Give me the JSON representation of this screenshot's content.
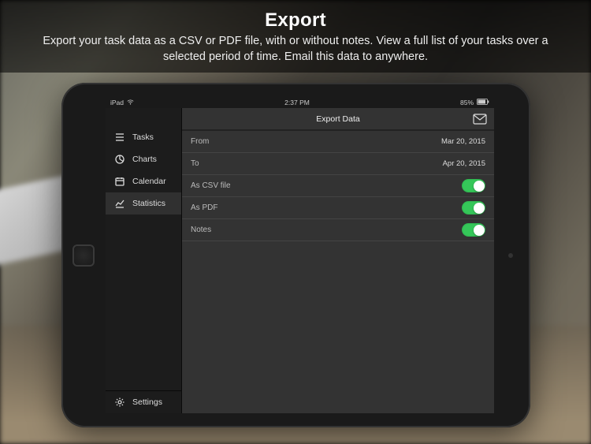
{
  "promo": {
    "title": "Export",
    "description": "Export your task data as a CSV or PDF file, with or without notes. View a full list of your tasks over a selected period of time. Email this data to anywhere."
  },
  "status": {
    "carrier": "iPad",
    "time": "2:37 PM",
    "battery": "85%"
  },
  "sidebar": {
    "items": [
      {
        "label": "Tasks"
      },
      {
        "label": "Charts"
      },
      {
        "label": "Calendar"
      },
      {
        "label": "Statistics"
      }
    ],
    "settings_label": "Settings",
    "selected_index": 3
  },
  "main": {
    "title": "Export Data",
    "rows": {
      "from": {
        "label": "From",
        "value": "Mar 20, 2015"
      },
      "to": {
        "label": "To",
        "value": "Apr 20, 2015"
      },
      "csv": {
        "label": "As CSV file",
        "on": true
      },
      "pdf": {
        "label": "As PDF",
        "on": true
      },
      "notes": {
        "label": "Notes",
        "on": true
      }
    }
  },
  "colors": {
    "accent_green": "#35c759"
  }
}
